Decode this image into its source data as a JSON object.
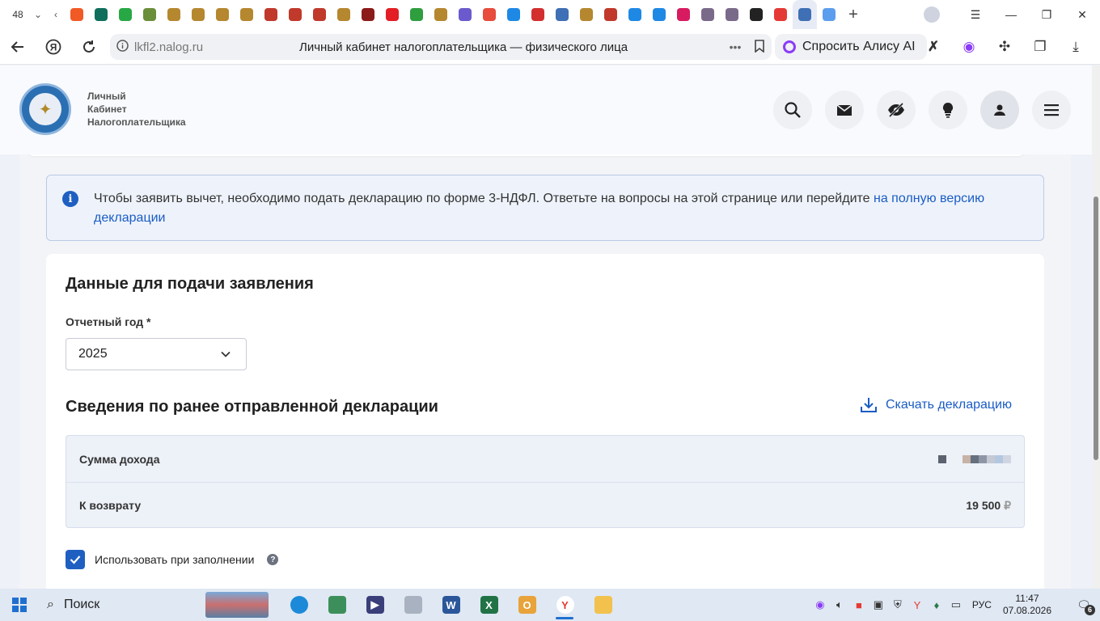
{
  "browser": {
    "tab_count": "48",
    "url_host": "lkfl2.nalog.ru",
    "page_title": "Личный кабинет налогоплательщика — физического лица",
    "alice_label": "Спросить Алису AI",
    "tab_favicon_colors": [
      "#f15a24",
      "#0f6f5c",
      "#27a844",
      "#6b8e3a",
      "#b5872f",
      "#b5872f",
      "#b5872f",
      "#b5872f",
      "#c0392b",
      "#c0392b",
      "#c0392b",
      "#b5872f",
      "#8b1a1a",
      "#e31e24",
      "#2e9e3e",
      "#b5872f",
      "#6a5acd",
      "#e74c3c",
      "#1e88e5",
      "#d32f2f",
      "#3f6fb5",
      "#b5872f",
      "#c0392b",
      "#1e88e5",
      "#1e88e5",
      "#d81b60",
      "#7a6a8a",
      "#7a6a8a",
      "#222222",
      "#e53935",
      "#3f6fb5",
      "#5c9ded"
    ]
  },
  "site": {
    "logo_lines": [
      "Личный",
      "Кабинет",
      "Налогоплательщика"
    ],
    "header_icons": [
      "search-icon",
      "mail-icon",
      "accessibility-icon",
      "bulb-icon",
      "user-icon",
      "menu-icon"
    ]
  },
  "info": {
    "text": "Чтобы заявить вычет, необходимо подать декларацию по форме 3-НДФЛ. Ответьте на вопросы на этой странице или перейдите ",
    "link": "на полную версию декларации"
  },
  "form": {
    "title": "Данные для подачи заявления",
    "year_label": "Отчетный год *",
    "year_value": "2025",
    "prev_title": "Сведения по ранее отправленной декларации",
    "download_label": "Скачать декларацию",
    "rows": [
      {
        "label": "Сумма дохода",
        "value": ""
      },
      {
        "label": "К возврату",
        "value": "19 500",
        "currency": "₽"
      }
    ],
    "checkbox_label": "Использовать при заполнении",
    "checkbox_checked": true
  },
  "taskbar": {
    "search_label": "Поиск",
    "lang": "РУС",
    "time": "11:47",
    "date": "07.08.2026",
    "notifications": "6"
  },
  "colors": {
    "accent": "#1f5fc1",
    "link": "#1a5cc4"
  }
}
